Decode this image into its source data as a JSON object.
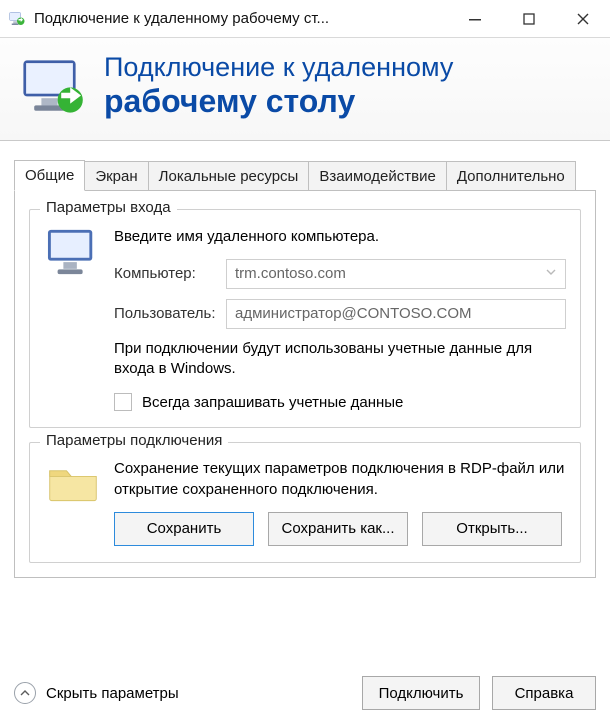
{
  "window": {
    "title": "Подключение к удаленному рабочему ст..."
  },
  "banner": {
    "line1": "Подключение к удаленному",
    "line2": "рабочему столу"
  },
  "tabs": [
    {
      "id": "general",
      "label": "Общие",
      "active": true
    },
    {
      "id": "display",
      "label": "Экран"
    },
    {
      "id": "local",
      "label": "Локальные ресурсы"
    },
    {
      "id": "experience",
      "label": "Взаимодействие"
    },
    {
      "id": "advanced",
      "label": "Дополнительно"
    }
  ],
  "login": {
    "legend": "Параметры входа",
    "intro": "Введите имя удаленного компьютера.",
    "computer_label": "Компьютер:",
    "computer_value": "trm.contoso.com",
    "user_label": "Пользователь:",
    "user_value": "администратор@CONTOSO.COM",
    "hint": "При подключении будут использованы учетные данные для входа в Windows.",
    "always_ask": "Всегда запрашивать учетные данные"
  },
  "conn": {
    "legend": "Параметры подключения",
    "desc": "Сохранение текущих параметров подключения в RDP-файл или открытие сохраненного подключения.",
    "save": "Сохранить",
    "save_as": "Сохранить как...",
    "open": "Открыть..."
  },
  "footer": {
    "hide": "Скрыть параметры",
    "connect": "Подключить",
    "help": "Справка"
  }
}
